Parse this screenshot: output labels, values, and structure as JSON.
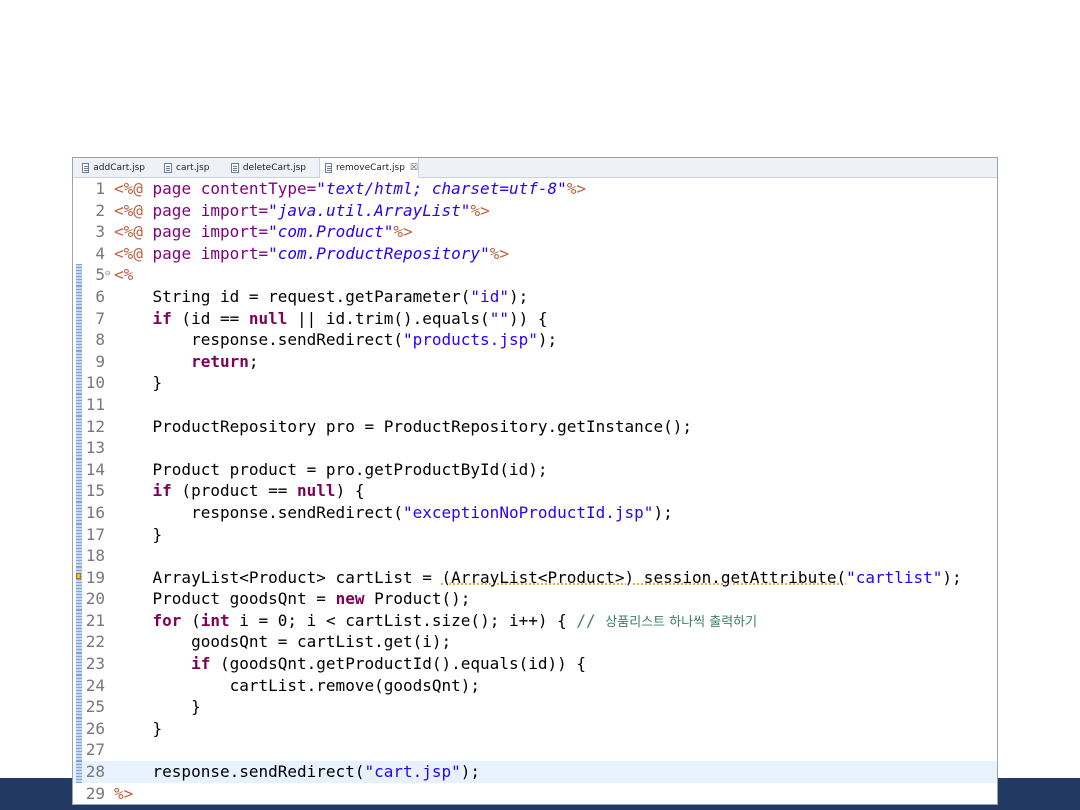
{
  "tabs": [
    {
      "label": "addCart.jsp",
      "active": false
    },
    {
      "label": "cart.jsp",
      "active": false
    },
    {
      "label": "deleteCart.jsp",
      "active": false
    },
    {
      "label": "removeCart.jsp",
      "active": true
    }
  ],
  "close_glyph": "☒",
  "current_line": 28,
  "lines": [
    {
      "n": "1",
      "tokens": [
        {
          "t": "<%@",
          "c": "jsp"
        },
        {
          "t": " page ",
          "c": "attr"
        },
        {
          "t": "contentType=",
          "c": "attr"
        },
        {
          "t": "\"text/html; charset=utf-8\"",
          "c": "astr"
        },
        {
          "t": "%>",
          "c": "jsp"
        }
      ]
    },
    {
      "n": "2",
      "tokens": [
        {
          "t": "<%@",
          "c": "jsp"
        },
        {
          "t": " page ",
          "c": "attr"
        },
        {
          "t": "import=",
          "c": "attr"
        },
        {
          "t": "\"java.util.ArrayList\"",
          "c": "astr"
        },
        {
          "t": "%>",
          "c": "jsp"
        }
      ]
    },
    {
      "n": "3",
      "tokens": [
        {
          "t": "<%@",
          "c": "jsp"
        },
        {
          "t": " page ",
          "c": "attr"
        },
        {
          "t": "import=",
          "c": "attr"
        },
        {
          "t": "\"com.Product\"",
          "c": "astr"
        },
        {
          "t": "%>",
          "c": "jsp"
        }
      ]
    },
    {
      "n": "4",
      "tokens": [
        {
          "t": "<%@",
          "c": "jsp"
        },
        {
          "t": " page ",
          "c": "attr"
        },
        {
          "t": "import=",
          "c": "attr"
        },
        {
          "t": "\"com.ProductRepository\"",
          "c": "astr"
        },
        {
          "t": "%>",
          "c": "jsp"
        }
      ]
    },
    {
      "n": "5",
      "fold": true,
      "tokens": [
        {
          "t": "<%",
          "c": "jsp"
        }
      ]
    },
    {
      "n": "6",
      "tokens": [
        {
          "t": "    String id = request.getParameter(",
          "c": "plain"
        },
        {
          "t": "\"id\"",
          "c": "str"
        },
        {
          "t": ");",
          "c": "plain"
        }
      ]
    },
    {
      "n": "7",
      "tokens": [
        {
          "t": "    ",
          "c": "plain"
        },
        {
          "t": "if",
          "c": "kw"
        },
        {
          "t": " (id == ",
          "c": "plain"
        },
        {
          "t": "null",
          "c": "kw"
        },
        {
          "t": " || id.trim().equals(",
          "c": "plain"
        },
        {
          "t": "\"\"",
          "c": "str"
        },
        {
          "t": ")) {",
          "c": "plain"
        }
      ]
    },
    {
      "n": "8",
      "tokens": [
        {
          "t": "        response.sendRedirect(",
          "c": "plain"
        },
        {
          "t": "\"products.jsp\"",
          "c": "str"
        },
        {
          "t": ");",
          "c": "plain"
        }
      ]
    },
    {
      "n": "9",
      "tokens": [
        {
          "t": "        ",
          "c": "plain"
        },
        {
          "t": "return",
          "c": "kw"
        },
        {
          "t": ";",
          "c": "plain"
        }
      ]
    },
    {
      "n": "10",
      "tokens": [
        {
          "t": "    }",
          "c": "plain"
        }
      ]
    },
    {
      "n": "11",
      "tokens": []
    },
    {
      "n": "12",
      "tokens": [
        {
          "t": "    ProductRepository pro = ProductRepository.getInstance();",
          "c": "plain"
        }
      ]
    },
    {
      "n": "13",
      "tokens": []
    },
    {
      "n": "14",
      "tokens": [
        {
          "t": "    Product product = pro.getProductById(id);",
          "c": "plain"
        }
      ]
    },
    {
      "n": "15",
      "tokens": [
        {
          "t": "    ",
          "c": "plain"
        },
        {
          "t": "if",
          "c": "kw"
        },
        {
          "t": " (product == ",
          "c": "plain"
        },
        {
          "t": "null",
          "c": "kw"
        },
        {
          "t": ") {",
          "c": "plain"
        }
      ]
    },
    {
      "n": "16",
      "tokens": [
        {
          "t": "        response.sendRedirect(",
          "c": "plain"
        },
        {
          "t": "\"exceptionNoProductId.jsp\"",
          "c": "str"
        },
        {
          "t": ");",
          "c": "plain"
        }
      ]
    },
    {
      "n": "17",
      "tokens": [
        {
          "t": "    }",
          "c": "plain"
        }
      ]
    },
    {
      "n": "18",
      "tokens": []
    },
    {
      "n": "19",
      "warn": true,
      "tokens": [
        {
          "t": "    ArrayList<Product> cartList = ",
          "c": "plain"
        },
        {
          "t": "(ArrayList<Product>) session.getAttribute(",
          "c": "warn"
        },
        {
          "t": "\"cartlist\"",
          "c": "str"
        },
        {
          "t": ");",
          "c": "plain"
        }
      ]
    },
    {
      "n": "20",
      "tokens": [
        {
          "t": "    Product goodsQnt = ",
          "c": "plain"
        },
        {
          "t": "new",
          "c": "kw"
        },
        {
          "t": " Product();",
          "c": "plain"
        }
      ]
    },
    {
      "n": "21",
      "tokens": [
        {
          "t": "    ",
          "c": "plain"
        },
        {
          "t": "for",
          "c": "kw"
        },
        {
          "t": " (",
          "c": "plain"
        },
        {
          "t": "int",
          "c": "kw"
        },
        {
          "t": " i = 0; i < cartList.size(); i++) { ",
          "c": "plain"
        },
        {
          "t": "// ",
          "c": "cmt"
        },
        {
          "t": "상품리스트 하나씩 출력하기",
          "c": "cmtkr"
        }
      ]
    },
    {
      "n": "22",
      "tokens": [
        {
          "t": "        goodsQnt = cartList.get(i);",
          "c": "plain"
        }
      ]
    },
    {
      "n": "23",
      "tokens": [
        {
          "t": "        ",
          "c": "plain"
        },
        {
          "t": "if",
          "c": "kw"
        },
        {
          "t": " (goodsQnt.getProductId().equals(id)) {",
          "c": "plain"
        }
      ]
    },
    {
      "n": "24",
      "tokens": [
        {
          "t": "            cartList.remove(goodsQnt);",
          "c": "plain"
        }
      ]
    },
    {
      "n": "25",
      "tokens": [
        {
          "t": "        }",
          "c": "plain"
        }
      ]
    },
    {
      "n": "26",
      "tokens": [
        {
          "t": "    }",
          "c": "plain"
        }
      ]
    },
    {
      "n": "27",
      "tokens": []
    },
    {
      "n": "28",
      "tokens": [
        {
          "t": "    response.sendRedirect(",
          "c": "plain"
        },
        {
          "t": "\"cart.jsp\"",
          "c": "str"
        },
        {
          "t": ");",
          "c": "plain"
        }
      ]
    },
    {
      "n": "29",
      "tokens": [
        {
          "t": "%>",
          "c": "jsp"
        }
      ]
    }
  ],
  "colors": {
    "keyword": "#7f0055",
    "string": "#2a00ff",
    "jsp_delimiter": "#bf5f3f",
    "attribute": "#7f007f",
    "comment": "#3f7f5f",
    "current_line_highlight": "#e8f2fe",
    "bottom_band": "#223a63"
  }
}
